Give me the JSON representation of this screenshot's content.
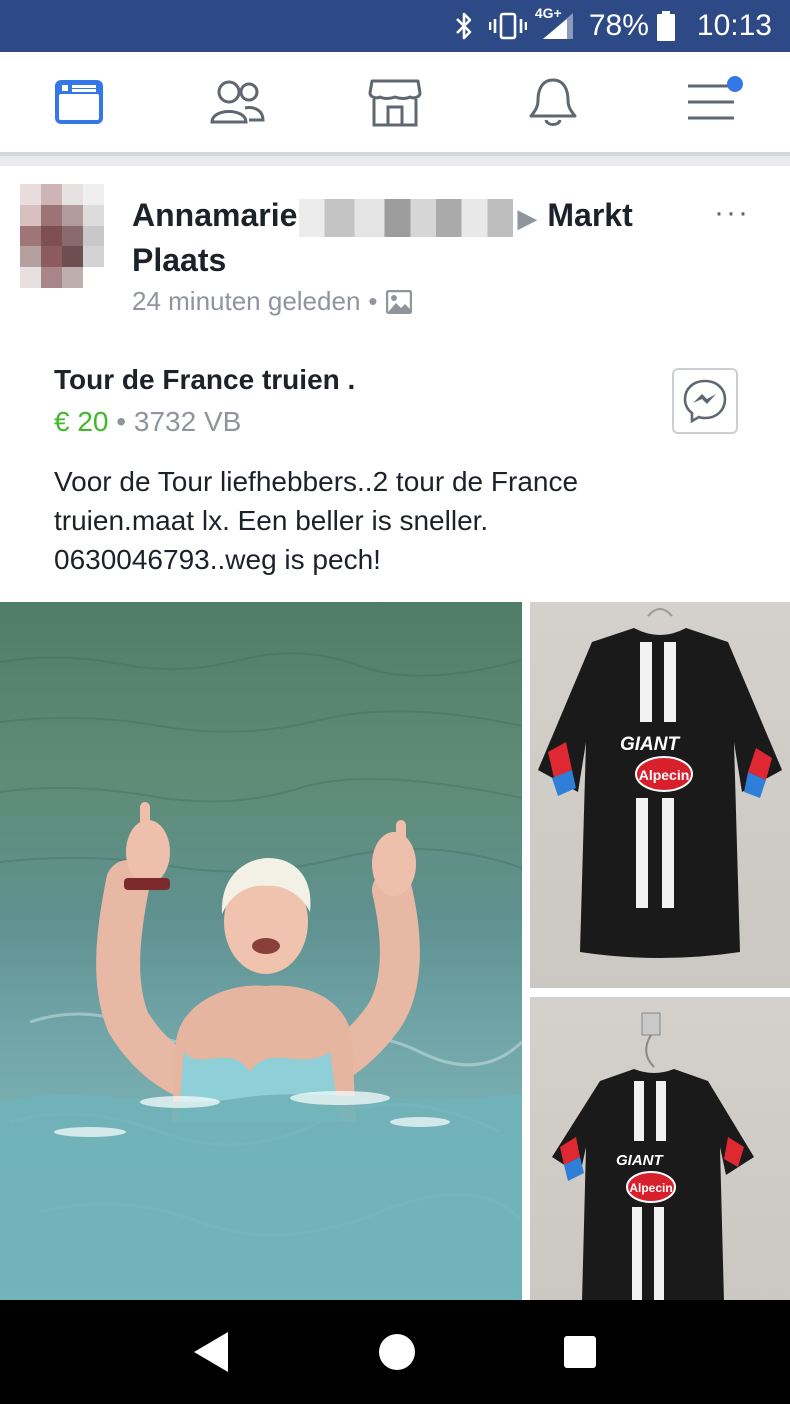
{
  "status_bar": {
    "network": "4G+",
    "battery": "78%",
    "time": "10:13",
    "icons": [
      "bluetooth-icon",
      "vibrate-icon",
      "signal-icon",
      "battery-icon"
    ]
  },
  "top_nav": {
    "items": [
      {
        "name": "news-feed",
        "icon": "news-feed-icon",
        "active": true
      },
      {
        "name": "friends",
        "icon": "friends-icon",
        "active": false
      },
      {
        "name": "marketplace",
        "icon": "marketplace-icon",
        "active": false
      },
      {
        "name": "notifications",
        "icon": "bell-icon",
        "active": false
      },
      {
        "name": "menu",
        "icon": "menu-icon",
        "active": false,
        "badge": true
      }
    ],
    "accent_color": "#3578e5"
  },
  "post": {
    "author": "Annamarie",
    "group_line1": "Markt",
    "group_line2": "Plaats",
    "timestamp": "24 minuten geleden",
    "separator": "•",
    "more": "···",
    "listing_title": "Tour de France truien .",
    "price": "€ 20",
    "price_sep": "•",
    "location": "3732 VB",
    "body_line1": "Voor de Tour liefhebbers..2 tour de France",
    "body_line2": "truien.maat lx. Een beller is sneller.",
    "body_line3": "0630046793..weg is pech!"
  },
  "photos": {
    "jersey_brand": "GIANT",
    "jersey_sponsor": "Alpecin"
  },
  "colors": {
    "status_bar": "#2e4a86",
    "price": "#42b72a",
    "text": "#1d2129",
    "meta": "#90949c"
  }
}
